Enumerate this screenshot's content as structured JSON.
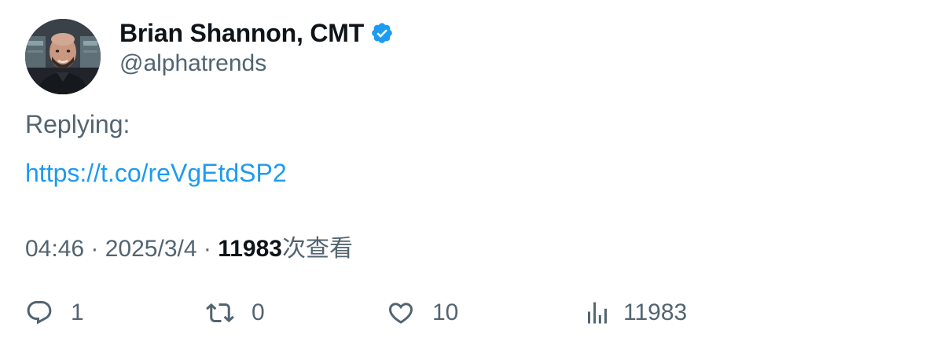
{
  "author": {
    "display_name": "Brian Shannon, CMT",
    "handle": "@alphatrends",
    "verified": true,
    "verified_color": "#1d9bf0"
  },
  "tweet": {
    "text": "Replying:",
    "link": "https://t.co/reVgEtdSP2",
    "time": "04:46",
    "date": "2025/3/4",
    "separator": "·",
    "views": "11983",
    "views_suffix": "次查看"
  },
  "actions": {
    "reply_count": "1",
    "retweet_count": "0",
    "like_count": "10",
    "views_count": "11983"
  },
  "colors": {
    "text_primary": "#0f1419",
    "text_secondary": "#536471",
    "link": "#1d9bf0"
  },
  "icons": {
    "verified": "verified-badge-icon",
    "reply": "reply-icon",
    "retweet": "retweet-icon",
    "like": "heart-icon",
    "views": "bar-chart-icon"
  }
}
